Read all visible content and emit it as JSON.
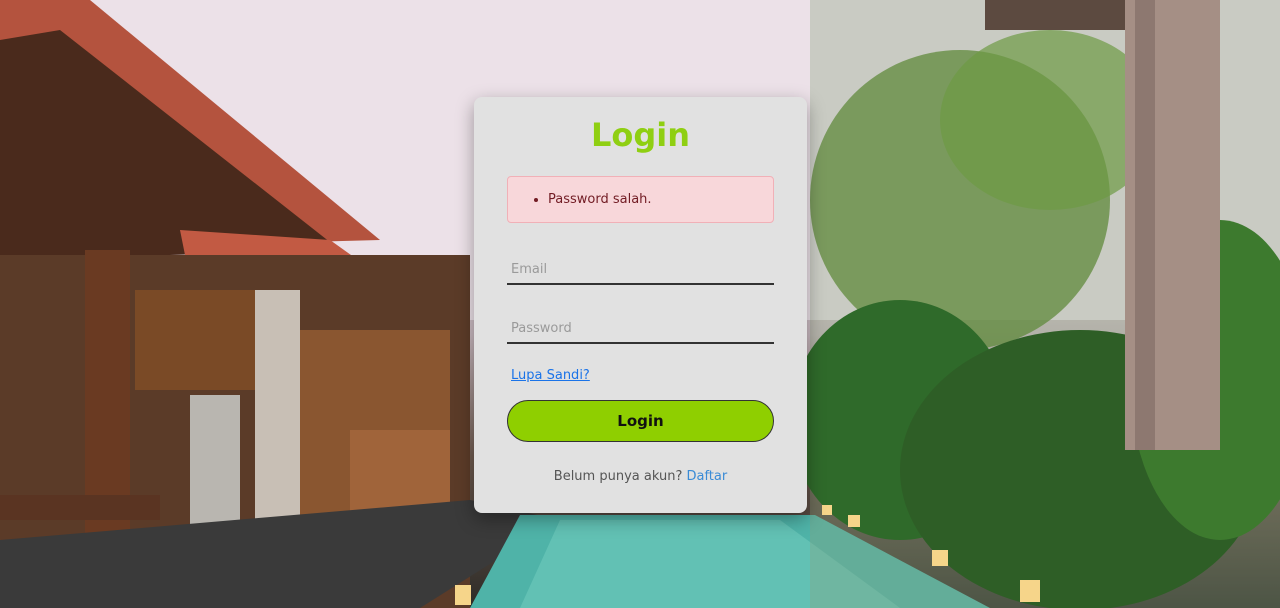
{
  "login_card": {
    "title": "Login",
    "error_messages": [
      "Password salah."
    ],
    "email_placeholder": "Email",
    "email_value": "",
    "password_placeholder": "Password",
    "password_value": "",
    "forgot_password_label": "Lupa Sandi?",
    "submit_label": "Login",
    "register_prompt": "Belum punya akun?",
    "register_link_label": "Daftar"
  },
  "colors": {
    "title": "#8fcf12",
    "button": "#8fcf00",
    "alert_bg": "#f8d7da",
    "alert_text": "#721c24",
    "link": "#1a73e8"
  }
}
